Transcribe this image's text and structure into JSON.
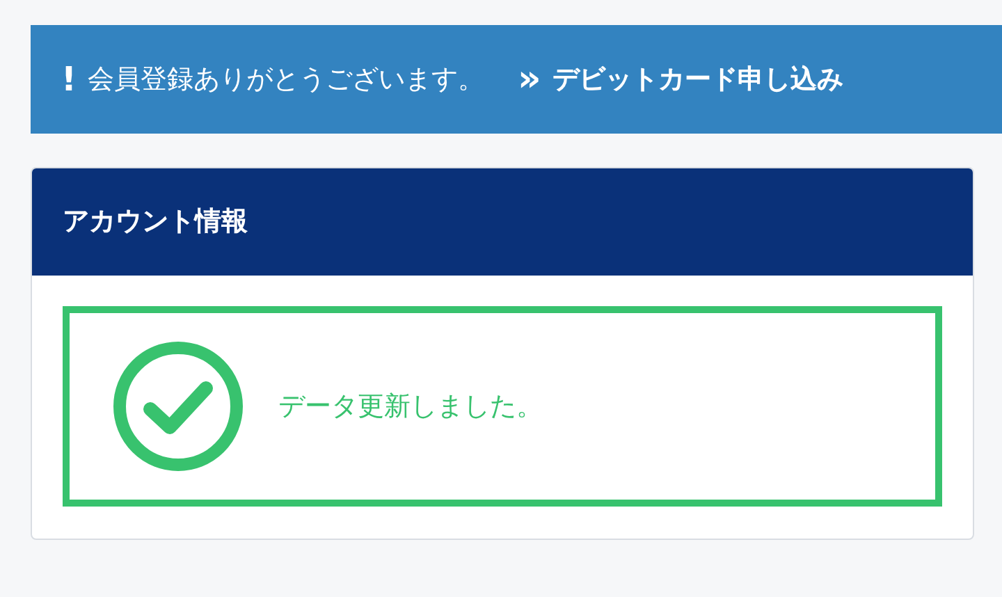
{
  "notice": {
    "mark": "!",
    "message": "会員登録ありがとうございます。",
    "link_mark": "»",
    "link": "デビットカード申し込み"
  },
  "card": {
    "title": "アカウント情報",
    "alert": {
      "message": "データ更新しました。"
    }
  }
}
